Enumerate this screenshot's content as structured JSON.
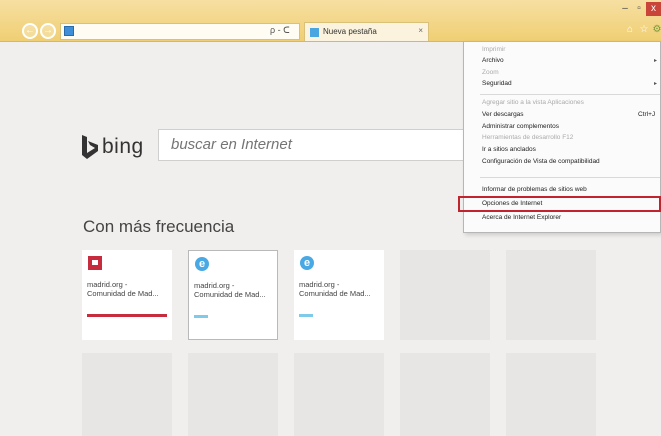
{
  "browser": {
    "tab_label": "Nueva pestaña",
    "tab_close": "×",
    "address_tools": "ρ - ᑕ",
    "back_glyph": "←",
    "forward_glyph": "→",
    "home_glyph": "⌂",
    "fav_glyph": "☆",
    "min_glyph": "–",
    "max_glyph": "▫",
    "close_glyph": "x",
    "icons": [
      "back-icon",
      "forward-icon",
      "ie-icon",
      "search-icon",
      "refresh-icon",
      "home-icon",
      "favorites-icon",
      "tools-icon"
    ]
  },
  "page": {
    "brand": "bing",
    "search_placeholder": "buscar en Internet",
    "section_title": "Con más frecuencia",
    "tiles": [
      {
        "title": "madrid.org -",
        "subtitle": "Comunidad de Mad...",
        "icon": "red-icon",
        "bar_color": "#c62c3d"
      },
      {
        "title": "madrid.org -",
        "subtitle": "Comunidad de Mad...",
        "icon": "ie-icon",
        "bar_color": "#7ecae9"
      },
      {
        "title": "madrid.org -",
        "subtitle": "Comunidad de Mad...",
        "icon": "ie-icon",
        "bar_color": "#7ecae9"
      }
    ]
  },
  "menu": {
    "items": [
      {
        "label": "Imprimir",
        "enabled": false
      },
      {
        "label": "Archivo",
        "enabled": true,
        "submenu": true
      },
      {
        "label": "Zoom",
        "enabled": false
      },
      {
        "label": "Seguridad",
        "enabled": true,
        "submenu": true
      },
      {
        "label": "Agregar sitio a la vista Aplicaciones",
        "enabled": false
      },
      {
        "label": "Ver descargas",
        "enabled": true,
        "shortcut": "Ctrl+J"
      },
      {
        "label": "Administrar complementos",
        "enabled": true
      },
      {
        "label": "Herramientas de desarrollo F12",
        "enabled": false
      },
      {
        "label": "Ir a sitios anclados",
        "enabled": true
      },
      {
        "label": "Configuración de Vista de compatibilidad",
        "enabled": true
      },
      {
        "label": "Informar de problemas de sitios web",
        "enabled": true
      },
      {
        "label": "Opciones de Internet",
        "enabled": true,
        "highlighted": true
      },
      {
        "label": "Acerca de Internet Explorer",
        "enabled": true
      }
    ]
  },
  "colors": {
    "accent": "#c0242f",
    "chrome": "#f0cf73",
    "bing": "#333333"
  }
}
